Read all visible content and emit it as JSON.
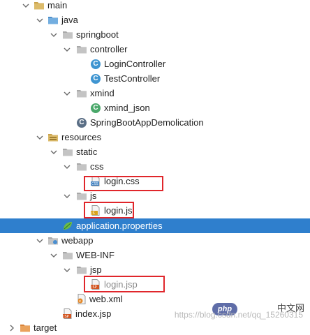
{
  "tree": {
    "main": "main",
    "java": "java",
    "springboot": "springboot",
    "controller": "controller",
    "login_controller": "LoginController",
    "test_controller": "TestController",
    "xmind": "xmind",
    "xmind_json": "xmind_json",
    "app_class": "SpringBootAppDemolication",
    "resources": "resources",
    "static": "static",
    "css": "css",
    "login_css": "login.css",
    "js": "js",
    "login_js": "login.js",
    "application_properties": "application.properties",
    "webapp": "webapp",
    "web_inf": "WEB-INF",
    "jsp": "jsp",
    "login_jsp": "login.jsp",
    "web_xml": "web.xml",
    "index_jsp": "index.jsp",
    "target": "target"
  },
  "watermark": {
    "site_badge": "php",
    "site_cn": "中文网",
    "url": "https://blog.csdn.net/qq_15260315"
  },
  "colors": {
    "selection": "#2f7fcd",
    "highlight_border": "#e0262b",
    "folder": "#c9a24b",
    "class_icon": "#3f95d1"
  }
}
